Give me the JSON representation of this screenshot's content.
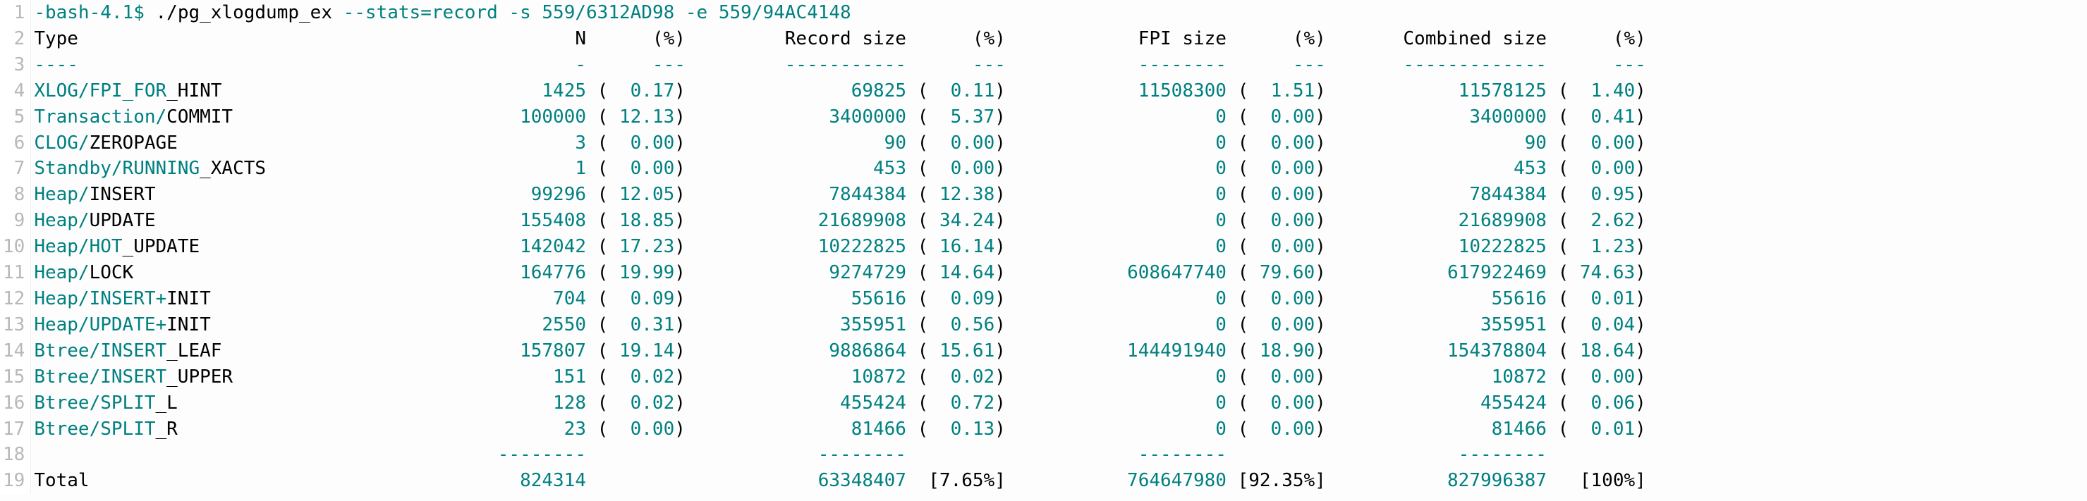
{
  "prompt": {
    "shell": "-bash-4.1$",
    "cmd": " ./pg_xlogdump_ex",
    "flag_stats": " --stats=record",
    "flag_s": " -s ",
    "arg_s": "559/6312AD98",
    "flag_e": " -e ",
    "arg_e": "559/94AC4148"
  },
  "header": [
    "Type",
    "N",
    "(%)",
    "Record size",
    "(%)",
    "FPI size",
    "(%)",
    "Combined size",
    "(%)"
  ],
  "sep": [
    "----",
    "-",
    "---",
    "-----------",
    "---",
    "--------",
    "---",
    "-------------",
    "---"
  ],
  "rows": [
    {
      "type_a": "XLOG/FPI_FOR",
      "type_b": "_HINT",
      "n": "1425",
      "np": "0.17",
      "rs": "69825",
      "rp": "0.11",
      "fs": "11508300",
      "fp": "1.51",
      "cs": "11578125",
      "cp": "1.40"
    },
    {
      "type_a": "Transaction/",
      "type_b": "COMMIT",
      "n": "100000",
      "np": "12.13",
      "rs": "3400000",
      "rp": "5.37",
      "fs": "0",
      "fp": "0.00",
      "cs": "3400000",
      "cp": "0.41"
    },
    {
      "type_a": "CLOG/",
      "type_b": "ZEROPAGE",
      "n": "3",
      "np": "0.00",
      "rs": "90",
      "rp": "0.00",
      "fs": "0",
      "fp": "0.00",
      "cs": "90",
      "cp": "0.00"
    },
    {
      "type_a": "Standby/RUNNING",
      "type_b": "_XACTS",
      "n": "1",
      "np": "0.00",
      "rs": "453",
      "rp": "0.00",
      "fs": "0",
      "fp": "0.00",
      "cs": "453",
      "cp": "0.00"
    },
    {
      "type_a": "Heap/",
      "type_b": "INSERT",
      "n": "99296",
      "np": "12.05",
      "rs": "7844384",
      "rp": "12.38",
      "fs": "0",
      "fp": "0.00",
      "cs": "7844384",
      "cp": "0.95"
    },
    {
      "type_a": "Heap/",
      "type_b": "UPDATE",
      "n": "155408",
      "np": "18.85",
      "rs": "21689908",
      "rp": "34.24",
      "fs": "0",
      "fp": "0.00",
      "cs": "21689908",
      "cp": "2.62"
    },
    {
      "type_a": "Heap/HOT",
      "type_b": "_UPDATE",
      "n": "142042",
      "np": "17.23",
      "rs": "10222825",
      "rp": "16.14",
      "fs": "0",
      "fp": "0.00",
      "cs": "10222825",
      "cp": "1.23"
    },
    {
      "type_a": "Heap/",
      "type_b": "LOCK",
      "n": "164776",
      "np": "19.99",
      "rs": "9274729",
      "rp": "14.64",
      "fs": "608647740",
      "fp": "79.60",
      "cs": "617922469",
      "cp": "74.63"
    },
    {
      "type_a": "Heap/INSERT+",
      "type_b": "INIT",
      "n": "704",
      "np": "0.09",
      "rs": "55616",
      "rp": "0.09",
      "fs": "0",
      "fp": "0.00",
      "cs": "55616",
      "cp": "0.01"
    },
    {
      "type_a": "Heap/UPDATE+",
      "type_b": "INIT",
      "n": "2550",
      "np": "0.31",
      "rs": "355951",
      "rp": "0.56",
      "fs": "0",
      "fp": "0.00",
      "cs": "355951",
      "cp": "0.04"
    },
    {
      "type_a": "Btree/INSERT",
      "type_b": "_LEAF",
      "n": "157807",
      "np": "19.14",
      "rs": "9886864",
      "rp": "15.61",
      "fs": "144491940",
      "fp": "18.90",
      "cs": "154378804",
      "cp": "18.64"
    },
    {
      "type_a": "Btree/INSERT",
      "type_b": "_UPPER",
      "n": "151",
      "np": "0.02",
      "rs": "10872",
      "rp": "0.02",
      "fs": "0",
      "fp": "0.00",
      "cs": "10872",
      "cp": "0.00"
    },
    {
      "type_a": "Btree/SPLIT",
      "type_b": "_L",
      "n": "128",
      "np": "0.02",
      "rs": "455424",
      "rp": "0.72",
      "fs": "0",
      "fp": "0.00",
      "cs": "455424",
      "cp": "0.06"
    },
    {
      "type_a": "Btree/SPLIT",
      "type_b": "_R",
      "n": "23",
      "np": "0.00",
      "rs": "81466",
      "rp": "0.13",
      "fs": "0",
      "fp": "0.00",
      "cs": "81466",
      "cp": "0.01"
    }
  ],
  "total_sep": "--------",
  "total": {
    "label": "Total",
    "n": "824314",
    "rs": "63348407",
    "rp": "[7.65%]",
    "fs": "764647980",
    "fp": "[92.35%]",
    "cs": "827996387",
    "cp": "[100%]"
  },
  "widths": {
    "type": 40,
    "n": 10,
    "pct": 6,
    "val": 20
  }
}
